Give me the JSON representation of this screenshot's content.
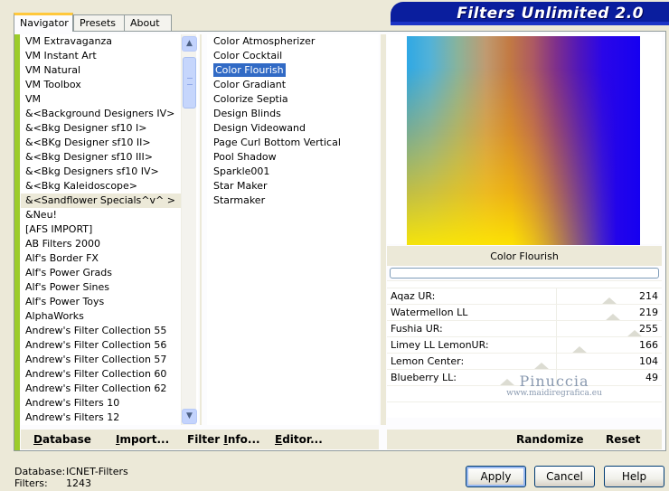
{
  "window": {
    "title_banner": "Filters Unlimited 2.0"
  },
  "tabs": [
    {
      "label": "Navigator",
      "active": true
    },
    {
      "label": "Presets",
      "active": false
    },
    {
      "label": "About",
      "active": false
    }
  ],
  "categories": {
    "items": [
      "VM Extravaganza",
      "VM Instant Art",
      "VM Natural",
      "VM Toolbox",
      "VM",
      "&<Background Designers IV>",
      "&<Bkg Designer sf10 I>",
      "&<BKg Designer sf10 II>",
      "&<Bkg Designer sf10 III>",
      "&<Bkg Designers sf10 IV>",
      "&<Bkg Kaleidoscope>",
      "&<Sandflower Specials^v^ >",
      "&Neu!",
      "[AFS IMPORT]",
      "AB Filters 2000",
      "Alf's Border FX",
      "Alf's Power Grads",
      "Alf's Power Sines",
      "Alf's Power Toys",
      "AlphaWorks",
      "Andrew's Filter Collection 55",
      "Andrew's Filter Collection 56",
      "Andrew's Filter Collection 57",
      "Andrew's Filter Collection 60",
      "Andrew's Filter Collection 62",
      "Andrew's Filters 10",
      "Andrew's Filters 12"
    ],
    "selected_index": 11
  },
  "filters": {
    "items": [
      "Color Atmospherizer",
      "Color Cocktail",
      "Color Flourish",
      "Color Gradiant",
      "Colorize Septia",
      "Design Blinds",
      "Design Videowand",
      "Page Curl Bottom Vertical",
      "Pool Shadow",
      "Sparkle001",
      "Star Maker",
      "Starmaker"
    ],
    "selected_index": 2
  },
  "preview": {
    "label": "Color Flourish"
  },
  "sliders": [
    {
      "name": "Aqaz UR:",
      "value": "214",
      "fraction": 0.84
    },
    {
      "name": "Watermellon LL",
      "value": "219",
      "fraction": 0.86
    },
    {
      "name": "Fushia UR:",
      "value": "255",
      "fraction": 1.0
    },
    {
      "name": "Limey LL LemonUR:",
      "value": "166",
      "fraction": 0.65
    },
    {
      "name": "Lemon Center:",
      "value": "104",
      "fraction": 0.41
    },
    {
      "name": "Blueberry LL:",
      "value": "49",
      "fraction": 0.19
    }
  ],
  "toolbar_left": {
    "database_first": "D",
    "database_rest": "atabase",
    "import_first": "I",
    "import_rest": "mport...",
    "filterinfo_first": "Filter ",
    "filterinfo_u": "I",
    "filterinfo_rest": "nfo...",
    "editor_first": "E",
    "editor_rest": "ditor..."
  },
  "toolbar_right": {
    "randomize": "Randomize",
    "reset": "Reset"
  },
  "status": {
    "database_label": "Database:",
    "database_value": "ICNET-Filters",
    "filters_label": "Filters:",
    "filters_value": "1243"
  },
  "dialog_buttons": {
    "apply": "Apply",
    "cancel": "Cancel",
    "help": "Help"
  },
  "watermark": {
    "line1": "Pinuccia",
    "line2": "www.maidiregrafica.eu"
  },
  "icons": {
    "scroll_up": "▲",
    "scroll_down": "▼"
  }
}
